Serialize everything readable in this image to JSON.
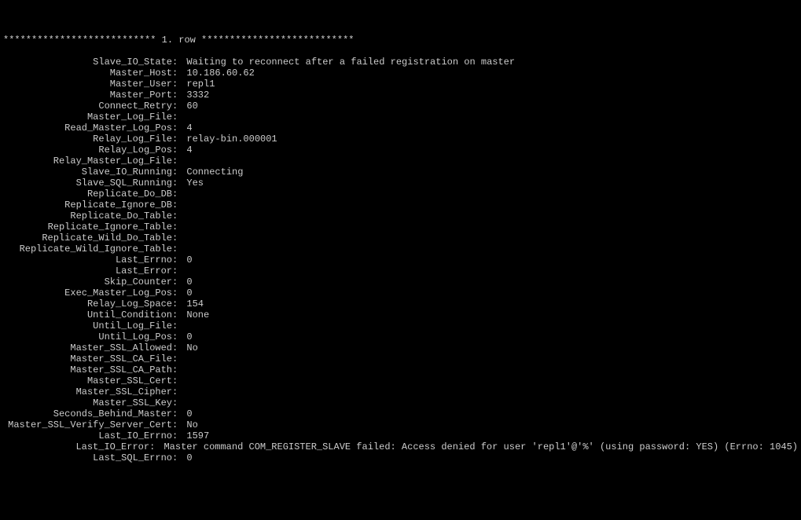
{
  "header": "*************************** 1. row ***************************",
  "fields": [
    {
      "label": "Slave_IO_State",
      "value": "Waiting to reconnect after a failed registration on master"
    },
    {
      "label": "Master_Host",
      "value": "10.186.60.62"
    },
    {
      "label": "Master_User",
      "value": "repl1"
    },
    {
      "label": "Master_Port",
      "value": "3332"
    },
    {
      "label": "Connect_Retry",
      "value": "60"
    },
    {
      "label": "Master_Log_File",
      "value": ""
    },
    {
      "label": "Read_Master_Log_Pos",
      "value": "4"
    },
    {
      "label": "Relay_Log_File",
      "value": "relay-bin.000001"
    },
    {
      "label": "Relay_Log_Pos",
      "value": "4"
    },
    {
      "label": "Relay_Master_Log_File",
      "value": ""
    },
    {
      "label": "Slave_IO_Running",
      "value": "Connecting"
    },
    {
      "label": "Slave_SQL_Running",
      "value": "Yes"
    },
    {
      "label": "Replicate_Do_DB",
      "value": ""
    },
    {
      "label": "Replicate_Ignore_DB",
      "value": ""
    },
    {
      "label": "Replicate_Do_Table",
      "value": ""
    },
    {
      "label": "Replicate_Ignore_Table",
      "value": ""
    },
    {
      "label": "Replicate_Wild_Do_Table",
      "value": ""
    },
    {
      "label": "Replicate_Wild_Ignore_Table",
      "value": ""
    },
    {
      "label": "Last_Errno",
      "value": "0"
    },
    {
      "label": "Last_Error",
      "value": ""
    },
    {
      "label": "Skip_Counter",
      "value": "0"
    },
    {
      "label": "Exec_Master_Log_Pos",
      "value": "0"
    },
    {
      "label": "Relay_Log_Space",
      "value": "154"
    },
    {
      "label": "Until_Condition",
      "value": "None"
    },
    {
      "label": "Until_Log_File",
      "value": ""
    },
    {
      "label": "Until_Log_Pos",
      "value": "0"
    },
    {
      "label": "Master_SSL_Allowed",
      "value": "No"
    },
    {
      "label": "Master_SSL_CA_File",
      "value": ""
    },
    {
      "label": "Master_SSL_CA_Path",
      "value": ""
    },
    {
      "label": "Master_SSL_Cert",
      "value": ""
    },
    {
      "label": "Master_SSL_Cipher",
      "value": ""
    },
    {
      "label": "Master_SSL_Key",
      "value": ""
    },
    {
      "label": "Seconds_Behind_Master",
      "value": "0"
    },
    {
      "label": "Master_SSL_Verify_Server_Cert",
      "value": "No"
    },
    {
      "label": "Last_IO_Errno",
      "value": "1597"
    },
    {
      "label": "Last_IO_Error",
      "value": "Master command COM_REGISTER_SLAVE failed: Access denied for user 'repl1'@'%' (using password: YES) (Errno: 1045)"
    },
    {
      "label": "Last_SQL_Errno",
      "value": "0"
    }
  ]
}
